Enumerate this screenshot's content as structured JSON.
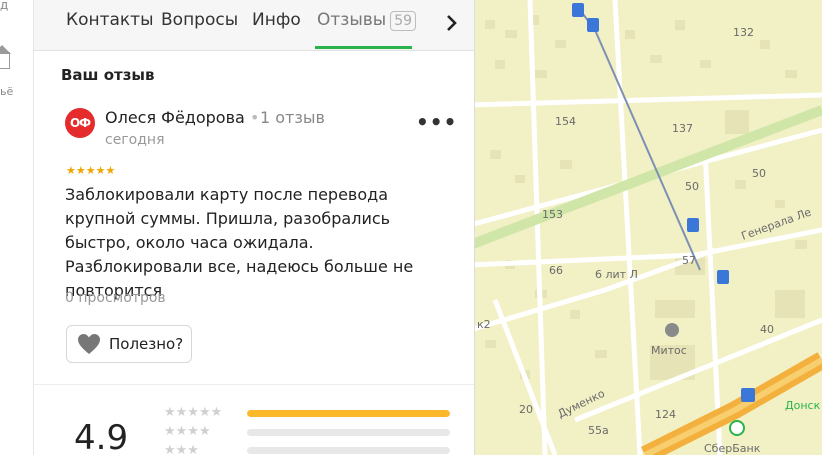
{
  "sidebar": {
    "top_text": "д",
    "bottom_text": "ьё"
  },
  "tabs": [
    {
      "label": "Контакты"
    },
    {
      "label": "Вопросы"
    },
    {
      "label": "Инфо"
    },
    {
      "label": "Отзывы",
      "badge": "59"
    }
  ],
  "review_section": {
    "heading": "Ваш отзыв",
    "author": {
      "initials": "ОФ",
      "name": "Олеся Фёдорова",
      "separator": "•",
      "review_count": "1 отзыв",
      "date": "сегодня"
    },
    "stars": 5,
    "stars_text": "★★★★★",
    "text": "Заблокировали карту после перевода крупной суммы. Пришла, разобрались быстро, около часа ожидала. Разблокировали все, надеюсь больше не повторится",
    "views": "0 просмотров",
    "useful_label": "Полезно?",
    "more_label": "•••"
  },
  "rating": {
    "value": "4.9",
    "distribution": [
      {
        "stars": "★★★★★",
        "fraction": 1.0
      },
      {
        "stars": "★★★★",
        "fraction": 0.0
      },
      {
        "stars": "★★★",
        "fraction": 0.0
      }
    ]
  },
  "map": {
    "labels": [
      "132",
      "154",
      "137",
      "50",
      "50",
      "153",
      "57",
      "66",
      "6 лит Л",
      "Генерала Ле",
      "Митос",
      "40",
      "к2",
      "Думенко",
      "124",
      "20",
      "55а",
      "СберБанк",
      "Донск"
    ],
    "colors": {
      "land": "#f2f0c5",
      "road": "#ffffff",
      "park": "#cfe6a8",
      "building": "#e3e0b4",
      "highway": "#f4b03d"
    }
  }
}
